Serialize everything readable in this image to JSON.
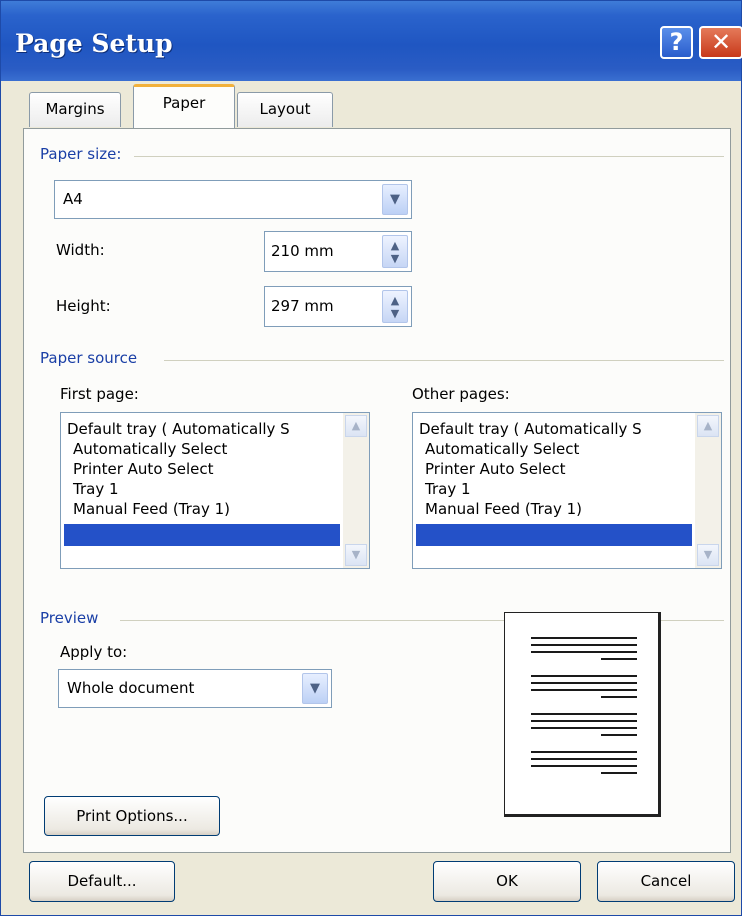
{
  "window": {
    "title": "Page Setup",
    "help_label": "?",
    "close_label": "✕"
  },
  "tabs": [
    {
      "label": "Margins",
      "selected": false
    },
    {
      "label": "Paper",
      "selected": true
    },
    {
      "label": "Layout",
      "selected": false
    }
  ],
  "paper_size": {
    "group_label": "Paper size:",
    "selected": "A4",
    "width_label": "Width:",
    "width_value": "210 mm",
    "height_label": "Height:",
    "height_value": "297 mm"
  },
  "paper_source": {
    "group_label": "Paper source",
    "first_page_label": "First page:",
    "other_pages_label": "Other pages:",
    "first_page_items": [
      "Default tray ( Automatically S",
      "Automatically Select",
      "Printer Auto Select",
      "Tray 1",
      "Manual Feed (Tray 1)"
    ],
    "other_pages_items": [
      "Default tray ( Automatically S",
      "Automatically Select",
      "Printer Auto Select",
      "Tray 1",
      "Manual Feed (Tray 1)"
    ]
  },
  "preview": {
    "group_label": "Preview",
    "apply_to_label": "Apply to:",
    "apply_to_value": "Whole document"
  },
  "buttons": {
    "print_options": "Print Options...",
    "default": "Default...",
    "ok": "OK",
    "cancel": "Cancel"
  },
  "colors": {
    "title_bar": "#2a63cc",
    "group_label": "#1a3fa6",
    "selection": "#2451c8",
    "tab_highlight": "#f2b13b"
  },
  "icons": {
    "help": "help-icon",
    "close": "close-icon",
    "dropdown": "chevron-down-icon",
    "spinner": "spinner-arrows-icon"
  }
}
